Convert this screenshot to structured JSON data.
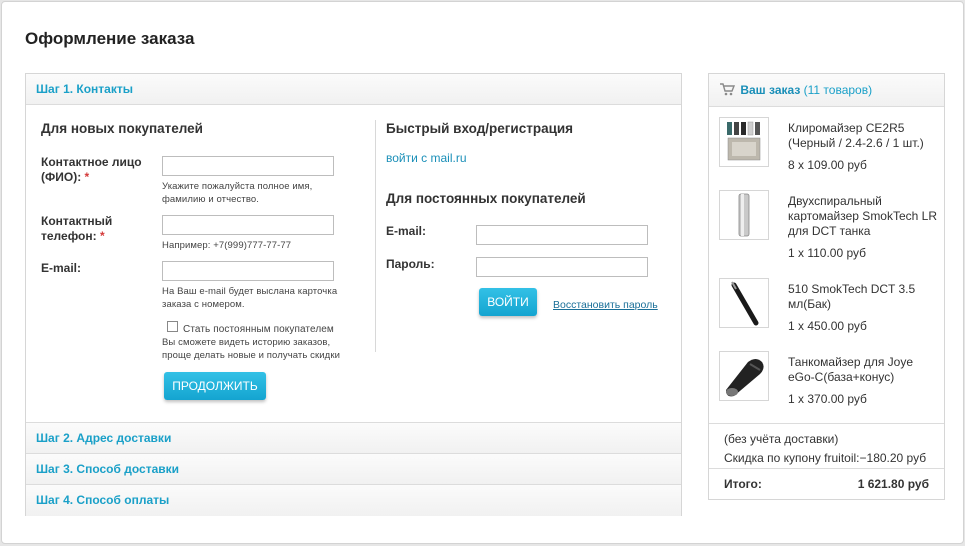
{
  "page": {
    "title": "Оформление заказа"
  },
  "steps": {
    "step1": "Шаг 1. Контакты",
    "step2": "Шаг 2. Адрес доставки",
    "step3": "Шаг 3. Способ доставки",
    "step4": "Шаг 4. Способ оплаты"
  },
  "new_customers": {
    "heading": "Для новых покупателей",
    "contact_label_1": "Контактное лицо",
    "contact_label_2": "(ФИО):",
    "contact_value": "",
    "contact_hint_1": "Укажите пожалуйста полное имя,",
    "contact_hint_2": "фамилию и отчество.",
    "phone_label_1": "Контактный",
    "phone_label_2": "телефон:",
    "phone_value": "",
    "phone_hint": "Например: +7(999)777-77-77",
    "email_label": "E-mail:",
    "email_value": "",
    "email_hint_1": "На Ваш e-mail будет выслана карточка",
    "email_hint_2": "заказа с номером.",
    "regular_checkbox_label": "Стать постоянным покупателем",
    "regular_hint_1": "Вы сможете видеть историю заказов,",
    "regular_hint_2": "проще делать новые и получать скидки",
    "continue_button": "ПРОДОЛЖИТЬ",
    "required_mark": "*"
  },
  "quick_login": {
    "heading": "Быстрый вход/регистрация",
    "mailru_link": "войти с mail.ru",
    "regular_heading": "Для постоянных покупателей",
    "email_label": "E-mail:",
    "email_value": "",
    "password_label": "Пароль:",
    "password_value": "",
    "login_button": "ВОЙТИ",
    "restore_link": "Восстановить пароль"
  },
  "cart": {
    "title": "Ваш заказ",
    "count": "(11 товаров)",
    "items": [
      {
        "name": "Клиромайзер CE2R5 (Черный / 2.4-2.6 / 1 шт.)",
        "price": "8 x 109.00 руб"
      },
      {
        "name": "Двухспиральный картомайзер SmokTech LR для DCT танка",
        "price": "1 x 110.00 руб"
      },
      {
        "name": "510 SmokTech DCT 3.5 мл(Бак)",
        "price": "1 x 450.00 руб"
      },
      {
        "name": "Танкомайзер для Joye eGo-C(база+конус)",
        "price": "1 x 370.00 руб"
      }
    ],
    "no_delivery": "(без учёта доставки)",
    "discount_label": "Скидка по купону fruitoil:",
    "discount_value": "−180.20 руб",
    "total_label": "Итого:",
    "total_value": "1 621.80 руб"
  },
  "colors": {
    "accent": "#1aa0c8",
    "button": "#1ba9d4",
    "required": "#d43a3a"
  }
}
